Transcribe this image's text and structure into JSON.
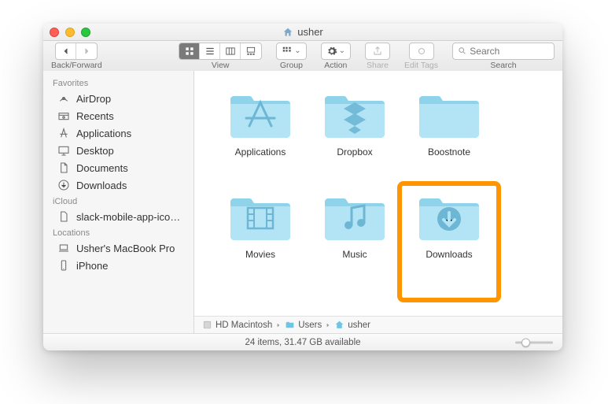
{
  "window": {
    "title": "usher"
  },
  "toolbar": {
    "back_forward_label": "Back/Forward",
    "view_label": "View",
    "group_label": "Group",
    "action_label": "Action",
    "share_label": "Share",
    "edit_tags_label": "Edit Tags",
    "search_label": "Search",
    "search_placeholder": "Search"
  },
  "sidebar": {
    "sections": [
      {
        "heading": "Favorites",
        "items": [
          {
            "icon": "airdrop",
            "label": "AirDrop"
          },
          {
            "icon": "recents",
            "label": "Recents"
          },
          {
            "icon": "applications",
            "label": "Applications"
          },
          {
            "icon": "desktop",
            "label": "Desktop"
          },
          {
            "icon": "documents",
            "label": "Documents"
          },
          {
            "icon": "downloads",
            "label": "Downloads"
          }
        ]
      },
      {
        "heading": "iCloud",
        "items": [
          {
            "icon": "file",
            "label": "slack-mobile-app-icon…"
          }
        ]
      },
      {
        "heading": "Locations",
        "items": [
          {
            "icon": "laptop",
            "label": "Usher's MacBook Pro"
          },
          {
            "icon": "iphone",
            "label": "iPhone"
          }
        ]
      }
    ]
  },
  "folders": [
    {
      "name": "Applications",
      "glyph": "app"
    },
    {
      "name": "Dropbox",
      "glyph": "dropbox"
    },
    {
      "name": "Boostnote",
      "glyph": "plain"
    },
    {
      "name": "Movies",
      "glyph": "movies"
    },
    {
      "name": "Music",
      "glyph": "music"
    },
    {
      "name": "Downloads",
      "glyph": "downloads",
      "highlighted": true
    }
  ],
  "pathbar": {
    "crumbs": [
      {
        "icon": "disk",
        "label": "HD Macintosh"
      },
      {
        "icon": "folder",
        "label": "Users"
      },
      {
        "icon": "home",
        "label": "usher"
      }
    ]
  },
  "status": {
    "text": "24 items, 31.47 GB available"
  }
}
